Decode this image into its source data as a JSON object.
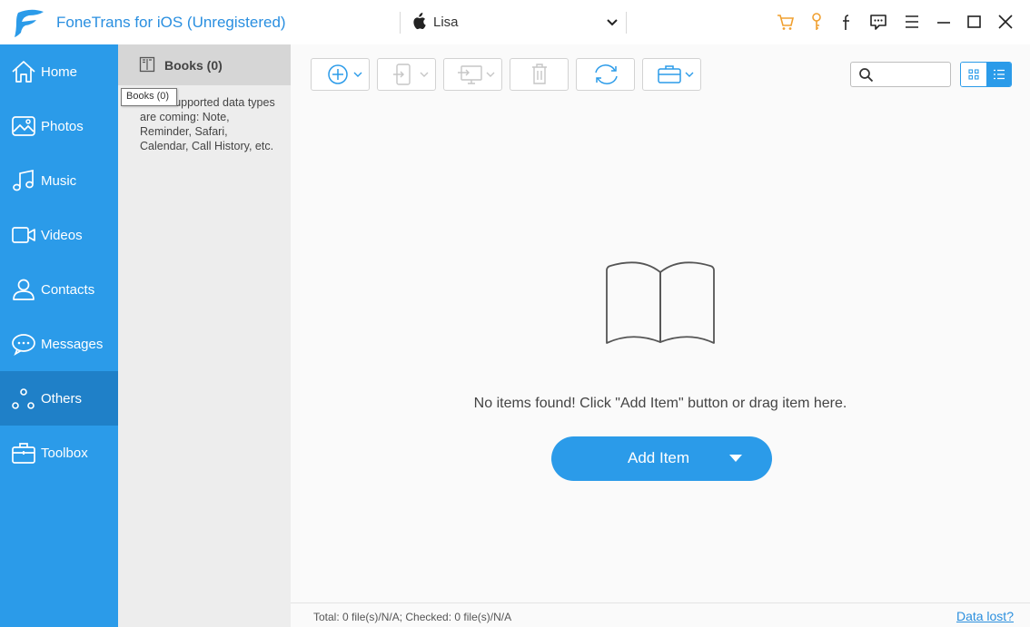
{
  "app": {
    "title": "FoneTrans for iOS (Unregistered)"
  },
  "device": {
    "name": "Lisa"
  },
  "titlebar_icons": [
    "cart-icon",
    "key-icon",
    "facebook-icon",
    "feedback-icon",
    "menu-icon",
    "minimize-icon",
    "maximize-icon",
    "close-icon"
  ],
  "sidebar": {
    "items": [
      {
        "label": "Home",
        "icon": "home-icon"
      },
      {
        "label": "Photos",
        "icon": "photos-icon"
      },
      {
        "label": "Music",
        "icon": "music-icon"
      },
      {
        "label": "Videos",
        "icon": "videos-icon"
      },
      {
        "label": "Contacts",
        "icon": "contacts-icon"
      },
      {
        "label": "Messages",
        "icon": "messages-icon"
      },
      {
        "label": "Others",
        "icon": "others-icon",
        "active": true
      },
      {
        "label": "Toolbox",
        "icon": "toolbox-icon"
      }
    ]
  },
  "category": {
    "title": "Books (0)",
    "tooltip": "Books (0)",
    "note": "More supported data types are coming: Note, Reminder, Safari, Calendar, Call History, etc."
  },
  "toolbar": {
    "buttons": [
      "add-icon",
      "export-to-device-icon",
      "export-to-pc-icon",
      "delete-icon",
      "refresh-icon",
      "toolbox-icon"
    ],
    "search_value": "",
    "view_mode": "list"
  },
  "main": {
    "empty_text": "No items found! Click \"Add Item\" button or drag item here.",
    "add_item_label": "Add Item"
  },
  "status": {
    "text": "Total: 0 file(s)/N/A; Checked: 0 file(s)/N/A",
    "link": "Data lost?"
  },
  "colors": {
    "accent": "#2b9be9",
    "sidebar_active": "#1f80c8",
    "title_text": "#2a8fe0",
    "cart_key": "#f0a030"
  }
}
